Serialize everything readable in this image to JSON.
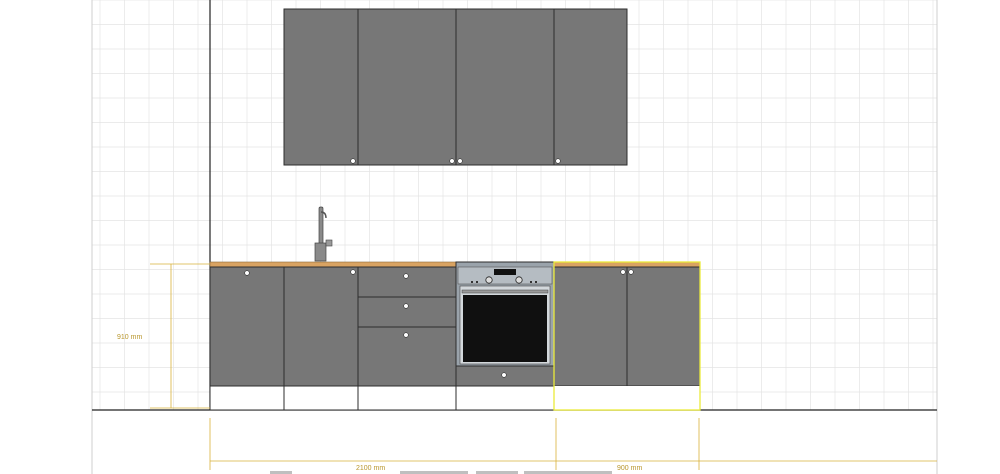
{
  "colors": {
    "background": "#ffffff",
    "grid_line": "#e4e4e4",
    "cabinet_fill": "#777777",
    "cabinet_stroke": "#2e2e2e",
    "countertop": "#d9a362",
    "dimension": "#d9b13a",
    "selection": "#eaea3a",
    "oven_frame": "#9aa3ab",
    "oven_glass": "#101010",
    "handle": "#ffffff"
  },
  "dimensions": {
    "height_label": "910 mm",
    "run_width_label": "2100 mm",
    "selected_width_label": "900 mm"
  },
  "icons": {
    "faucet": "kitchen-faucet-icon",
    "oven": "built-in-oven-icon",
    "handle": "cabinet-handle-icon"
  }
}
